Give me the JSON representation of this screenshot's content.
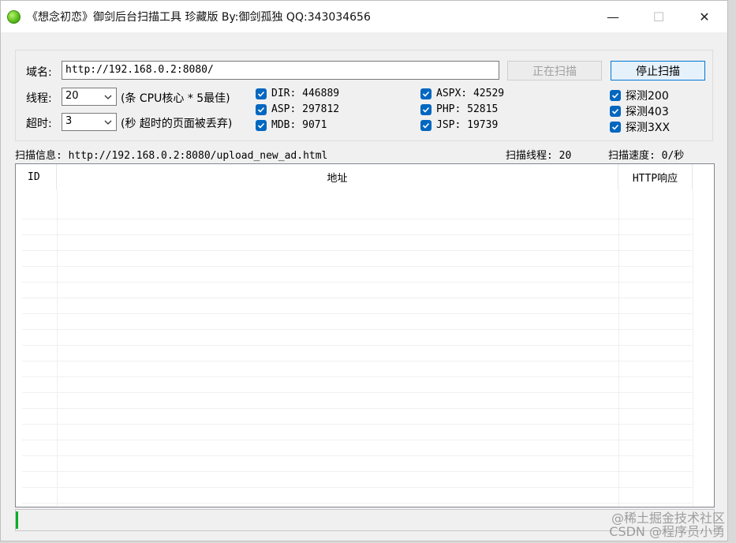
{
  "window": {
    "title": "《想念初恋》御剑后台扫描工具 珍藏版 By:御剑孤独 QQ:343034656",
    "minimize_glyph": "—",
    "maximize_glyph": "☐",
    "close_glyph": "✕"
  },
  "form": {
    "domain_label": "域名:",
    "domain_value": "http://192.168.0.2:8080/",
    "scanning_button": "正在扫描",
    "stop_button": "停止扫描",
    "threads_label": "线程:",
    "threads_value": "20",
    "threads_hint": "(条 CPU核心 * 5最佳)",
    "timeout_label": "超时:",
    "timeout_value": "3",
    "timeout_hint": "(秒 超时的页面被丢弃)"
  },
  "dictionaries": [
    {
      "label": "DIR: 446889",
      "checked": true
    },
    {
      "label": "ASP: 297812",
      "checked": true
    },
    {
      "label": "MDB: 9071",
      "checked": true
    },
    {
      "label": "ASPX: 42529",
      "checked": true
    },
    {
      "label": "PHP: 52815",
      "checked": true
    },
    {
      "label": "JSP: 19739",
      "checked": true
    }
  ],
  "probes": [
    {
      "label": "探测200",
      "checked": true
    },
    {
      "label": "探测403",
      "checked": true
    },
    {
      "label": "探测3XX",
      "checked": true
    }
  ],
  "scan_info": {
    "info": "扫描信息: http://192.168.0.2:8080/upload_new_ad.html",
    "threads": "扫描线程: 20",
    "speed": "扫描速度: 0/秒"
  },
  "results_table": {
    "columns": [
      "ID",
      "地址",
      "HTTP响应"
    ],
    "rows": []
  },
  "watermark": {
    "line1": "@稀土掘金技术社区",
    "line2": "CSDN @程序员小勇"
  },
  "colors": {
    "checkbox": "#0067c0",
    "progress": "#06b025",
    "primary_border": "#0078d7"
  }
}
